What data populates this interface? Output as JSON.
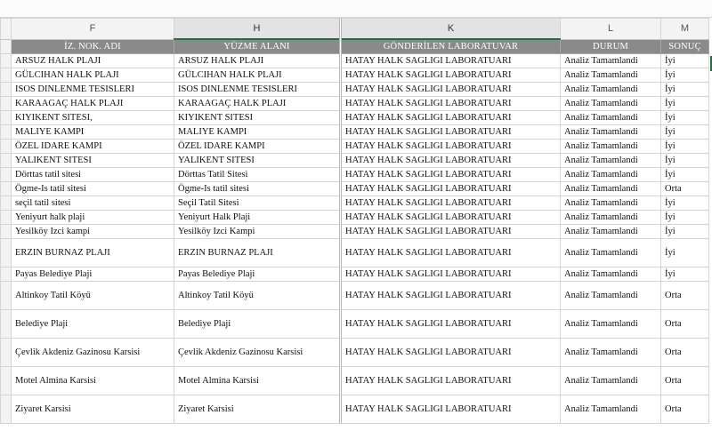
{
  "columns": [
    "F",
    "H",
    "K",
    "L",
    "M"
  ],
  "headers": [
    "İZ. NOK. ADI",
    "YÜZME ALANI",
    "GÖNDERİLEN LABORATUVAR",
    "DURUM",
    "SONUÇ"
  ],
  "rows": [
    [
      "ARSUZ HALK PLAJI",
      "ARSUZ HALK PLAJI",
      "HATAY HALK SAGLIGI LABORATUARI",
      "Analiz Tamamlandi",
      "İyi"
    ],
    [
      "GÜLCIHAN HALK PLAJI",
      "GÜLCIHAN HALK PLAJI",
      "HATAY HALK SAGLIGI LABORATUARI",
      "Analiz Tamamlandi",
      "İyi"
    ],
    [
      "ISOS DINLENME TESISLERI",
      "ISOS DINLENME TESISLERI",
      "HATAY HALK SAGLIGI LABORATUARI",
      "Analiz Tamamlandi",
      "İyi"
    ],
    [
      "KARAAGAÇ HALK PLAJI",
      "KARAAGAÇ HALK PLAJI",
      "HATAY HALK SAGLIGI LABORATUARI",
      "Analiz Tamamlandi",
      "İyi"
    ],
    [
      "KIYIKENT SITESI,",
      "KIYIKENT SITESI",
      "HATAY HALK SAGLIGI LABORATUARI",
      "Analiz Tamamlandi",
      "İyi"
    ],
    [
      "MALIYE KAMPI",
      "MALIYE KAMPI",
      "HATAY HALK SAGLIGI LABORATUARI",
      "Analiz Tamamlandi",
      "İyi"
    ],
    [
      "ÖZEL IDARE KAMPI",
      "ÖZEL IDARE KAMPI",
      "HATAY HALK SAGLIGI LABORATUARI",
      "Analiz Tamamlandi",
      "İyi"
    ],
    [
      "YALIKENT SITESI",
      "YALIKENT SITESI",
      "HATAY HALK SAGLIGI LABORATUARI",
      "Analiz Tamamlandi",
      "İyi"
    ],
    [
      "Dörttas tatil sitesi",
      "Dörttas Tatil Sitesi",
      "HATAY HALK SAGLIGI LABORATUARI",
      "Analiz Tamamlandi",
      "İyi"
    ],
    [
      "Ögme-Is tatil sitesi",
      "Ögme-Is tatil sitesi",
      "HATAY HALK SAGLIGI LABORATUARI",
      "Analiz Tamamlandi",
      "Orta"
    ],
    [
      "seçil tatil sitesi",
      "Seçil Tatil Sitesi",
      "HATAY HALK SAGLIGI LABORATUARI",
      "Analiz Tamamlandi",
      "İyi"
    ],
    [
      "Yeniyurt halk plaji",
      "Yeniyurt Halk Plaji",
      "HATAY HALK SAGLIGI LABORATUARI",
      "Analiz Tamamlandi",
      "İyi"
    ],
    [
      "Yesilköy Izci kampi",
      "Yesilköy Izci Kampi",
      "HATAY HALK SAGLIGI LABORATUARI",
      "Analiz Tamamlandi",
      "İyi"
    ],
    [
      "ERZIN BURNAZ PLAJI",
      "ERZIN  BURNAZ PLAJI",
      "HATAY HALK SAGLIGI LABORATUARI",
      "Analiz Tamamlandi",
      "İyi"
    ],
    [
      "Payas Belediye Plaji",
      "Payas Belediye Plaji",
      "HATAY HALK SAGLIGI LABORATUARI",
      "Analiz Tamamlandi",
      "İyi"
    ],
    [
      "Altinkoy Tatil Köyü",
      "Altinkoy Tatil Köyü",
      "HATAY HALK SAGLIGI LABORATUARI",
      "Analiz Tamamlandi",
      "Orta"
    ],
    [
      "Belediye Plaji",
      "Belediye Plaji",
      "HATAY HALK SAGLIGI LABORATUARI",
      "Analiz Tamamlandi",
      "Orta"
    ],
    [
      "Çevlik Akdeniz Gazinosu Karsisi",
      "Çevlik Akdeniz Gazinosu Karsisi",
      "HATAY HALK SAGLIGI LABORATUARI",
      "Analiz Tamamlandi",
      "Orta"
    ],
    [
      "Motel Almina Karsisi",
      "Motel Almina Karsisi",
      "HATAY HALK SAGLIGI LABORATUARI",
      "Analiz Tamamlandi",
      "Orta"
    ],
    [
      "Ziyaret Karsisi",
      "Ziyaret Karsisi",
      "HATAY HALK SAGLIGI LABORATUARI",
      "Analiz Tamamlandi",
      "Orta"
    ]
  ]
}
